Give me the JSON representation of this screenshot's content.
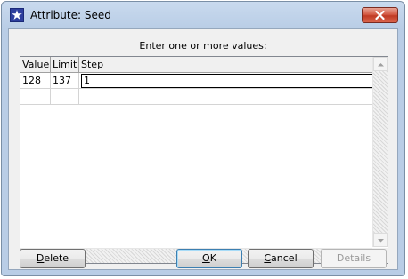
{
  "window": {
    "title": "Attribute: Seed",
    "icon": "star-app-icon",
    "close_icon": "close-x-icon"
  },
  "prompt": "Enter one or more values:",
  "table": {
    "columns": [
      "Value",
      "Limit",
      "Step"
    ],
    "rows": [
      [
        "128",
        "137",
        "1"
      ]
    ]
  },
  "buttons": {
    "delete": {
      "mnemonic": "D",
      "rest": "elete"
    },
    "ok": {
      "mnemonic": "O",
      "rest": "K"
    },
    "cancel": {
      "mnemonic": "C",
      "rest": "ancel"
    },
    "details": "Details"
  }
}
